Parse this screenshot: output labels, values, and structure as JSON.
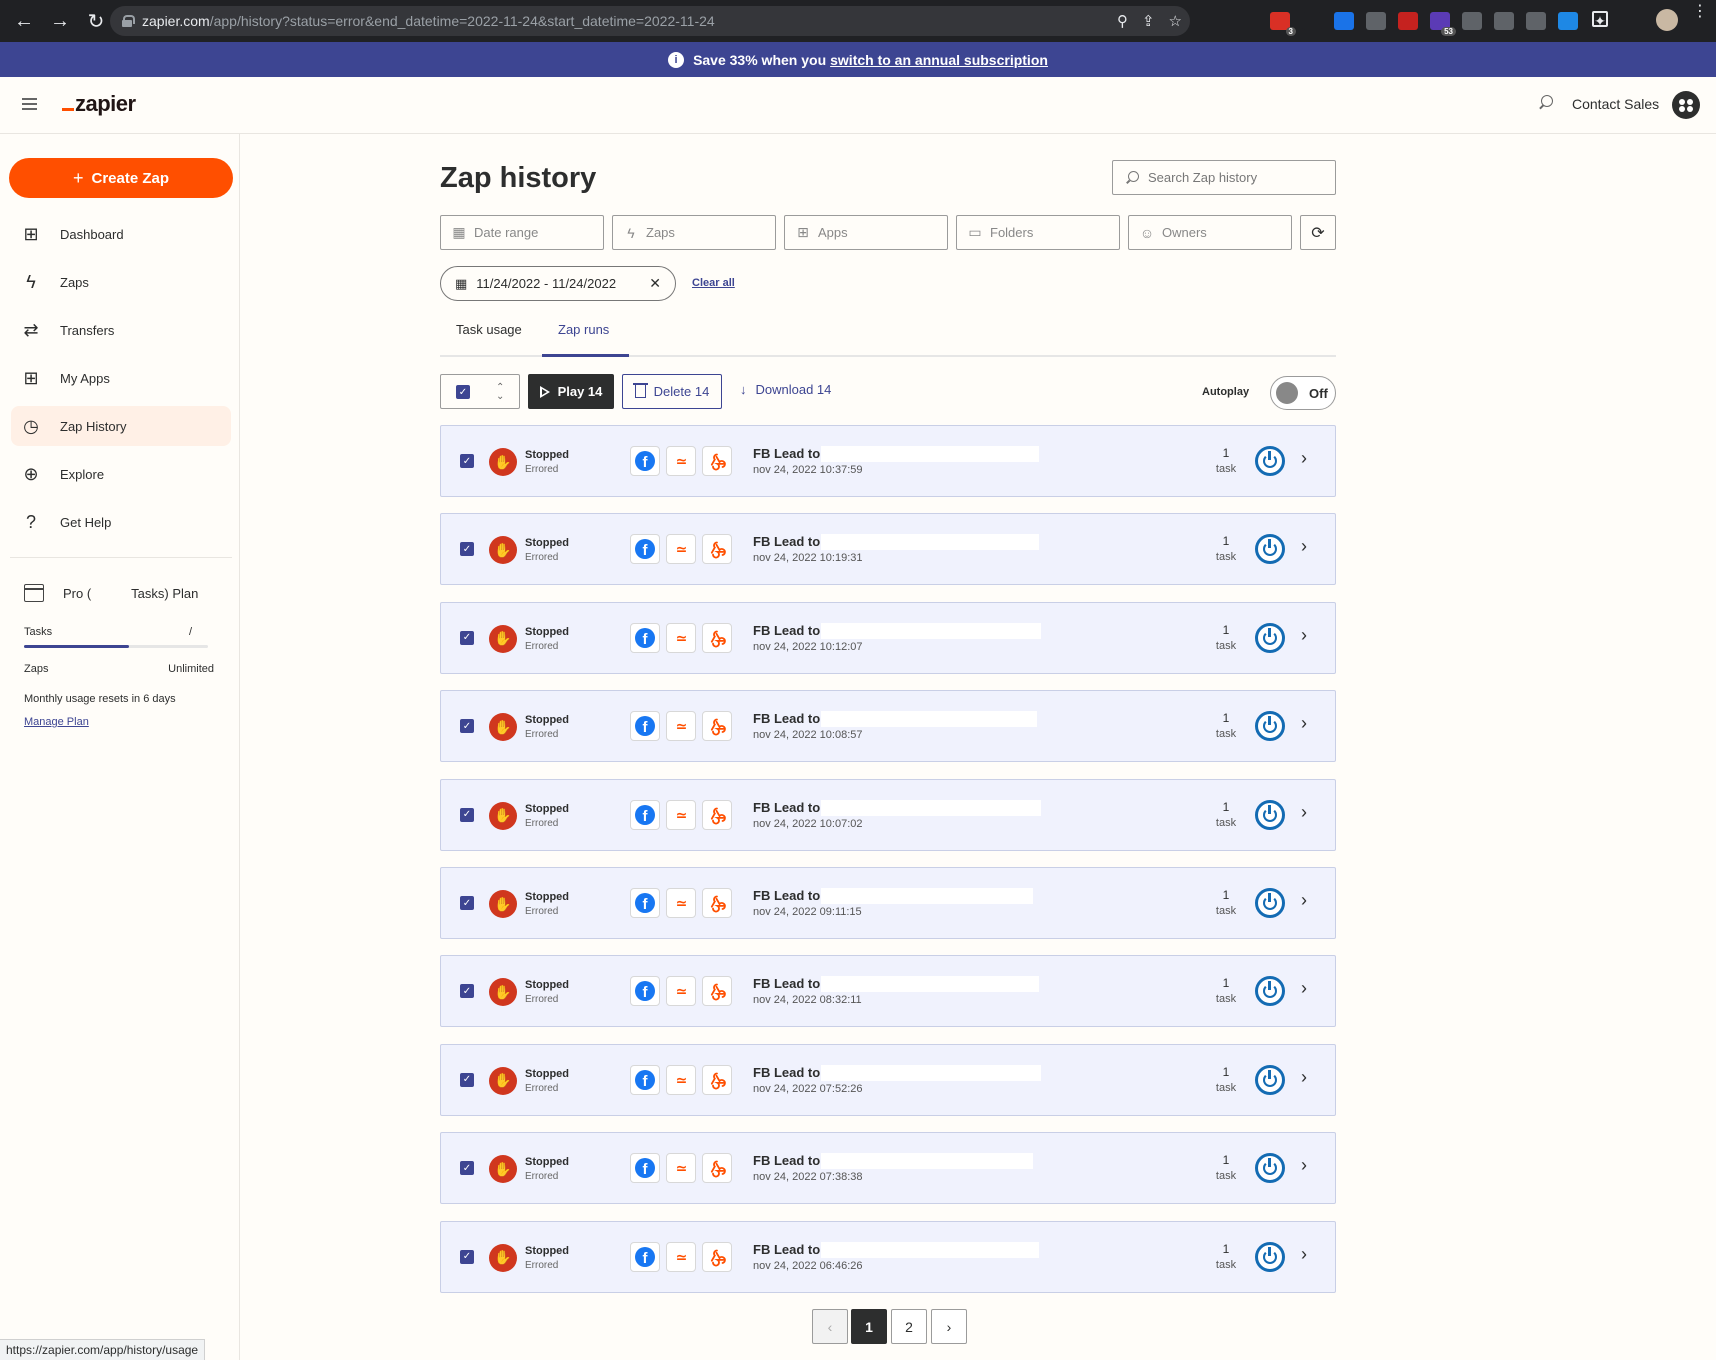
{
  "browser": {
    "url_host": "zapier.com",
    "url_path": "/app/history?status=error&end_datetime=2022-11-24&start_datetime=2022-11-24",
    "extensions": [
      {
        "icon": "red-ext-icon",
        "color": "#d93025",
        "badge": "3"
      },
      {
        "icon": "e-ext-icon",
        "color": "#202124",
        "badge": ""
      },
      {
        "icon": "blue-ext-icon",
        "color": "#1a73e8",
        "badge": ""
      },
      {
        "icon": "code-ext-icon",
        "color": "#5f6368",
        "badge": ""
      },
      {
        "icon": "dots-ext-icon",
        "color": "#c5221f",
        "badge": ""
      },
      {
        "icon": "purple-ext-icon",
        "color": "#5b3bb5",
        "badge": "53"
      },
      {
        "icon": "d-ext-icon",
        "color": "#5f6368",
        "badge": ""
      },
      {
        "icon": "pill-ext-icon",
        "color": "#5f6368",
        "badge": ""
      },
      {
        "icon": "glasses-ext-icon",
        "color": "#5f6368",
        "badge": ""
      },
      {
        "icon": "snowflake-ext-icon",
        "color": "#1e88e5",
        "badge": ""
      }
    ]
  },
  "promo": {
    "text": "Save 33% when you",
    "link": "switch to an annual subscription"
  },
  "header": {
    "logo": "zapier",
    "contact_sales": "Contact Sales"
  },
  "sidebar": {
    "create_zap": "Create Zap",
    "items": [
      {
        "label": "Dashboard",
        "icon": "dashboard-icon",
        "glyph": "⊞"
      },
      {
        "label": "Zaps",
        "icon": "zap-icon",
        "glyph": "ϟ"
      },
      {
        "label": "Transfers",
        "icon": "transfers-icon",
        "glyph": "⇄"
      },
      {
        "label": "My Apps",
        "icon": "apps-icon",
        "glyph": "⊞"
      },
      {
        "label": "Zap History",
        "icon": "history-icon",
        "glyph": "◷",
        "active": true
      },
      {
        "label": "Explore",
        "icon": "explore-icon",
        "glyph": "⊕"
      },
      {
        "label": "Get Help",
        "icon": "help-icon",
        "glyph": "?"
      }
    ],
    "plan": {
      "title_start": "Pro (",
      "title_end": "Tasks) Plan",
      "tasks_label": "Tasks",
      "tasks_value": "/",
      "tasks_progress": 0.57,
      "zaps_label": "Zaps",
      "zaps_value": "Unlimited",
      "reset_text": "Monthly usage resets in 6 days",
      "manage_link": "Manage Plan"
    }
  },
  "main": {
    "title": "Zap history",
    "search_placeholder": "Search Zap history",
    "filters": [
      {
        "label": "Date range",
        "icon": "calendar-icon"
      },
      {
        "label": "Zaps",
        "icon": "zap-icon"
      },
      {
        "label": "Apps",
        "icon": "apps-icon"
      },
      {
        "label": "Folders",
        "icon": "folder-icon"
      },
      {
        "label": "Owners",
        "icon": "user-icon"
      }
    ],
    "date_chip": "11/24/2022 - 11/24/2022",
    "clear_all": "Clear all",
    "tabs": [
      {
        "label": "Task usage"
      },
      {
        "label": "Zap runs",
        "active": true
      }
    ],
    "toolbar": {
      "play": "Play 14",
      "delete": "Delete 14",
      "download": "Download 14",
      "autoplay_label": "Autoplay",
      "autoplay_state": "Off"
    },
    "runs": [
      {
        "status": "Stopped",
        "sub": "Errored",
        "name": "FB Lead to",
        "time": "nov 24, 2022 10:37:59",
        "count": "1",
        "unit": "task"
      },
      {
        "status": "Stopped",
        "sub": "Errored",
        "name": "FB Lead to",
        "time": "nov 24, 2022 10:19:31",
        "count": "1",
        "unit": "task"
      },
      {
        "status": "Stopped",
        "sub": "Errored",
        "name": "FB Lead to",
        "time": "nov 24, 2022 10:12:07",
        "count": "1",
        "unit": "task"
      },
      {
        "status": "Stopped",
        "sub": "Errored",
        "name": "FB Lead to",
        "time": "nov 24, 2022 10:08:57",
        "count": "1",
        "unit": "task"
      },
      {
        "status": "Stopped",
        "sub": "Errored",
        "name": "FB Lead to",
        "time": "nov 24, 2022 10:07:02",
        "count": "1",
        "unit": "task"
      },
      {
        "status": "Stopped",
        "sub": "Errored",
        "name": "FB Lead to",
        "time": "nov 24, 2022 09:11:15",
        "count": "1",
        "unit": "task"
      },
      {
        "status": "Stopped",
        "sub": "Errored",
        "name": "FB Lead to",
        "time": "nov 24, 2022 08:32:11",
        "count": "1",
        "unit": "task"
      },
      {
        "status": "Stopped",
        "sub": "Errored",
        "name": "FB Lead to",
        "time": "nov 24, 2022 07:52:26",
        "count": "1",
        "unit": "task"
      },
      {
        "status": "Stopped",
        "sub": "Errored",
        "name": "FB Lead to",
        "time": "nov 24, 2022 07:38:38",
        "count": "1",
        "unit": "task"
      },
      {
        "status": "Stopped",
        "sub": "Errored",
        "name": "FB Lead to",
        "time": "nov 24, 2022 06:46:26",
        "count": "1",
        "unit": "task"
      }
    ],
    "pagination": {
      "prev": "‹",
      "pages": [
        "1",
        "2"
      ],
      "current": "1",
      "next": "›"
    }
  },
  "status_bar_url": "https://zapier.com/app/history/usage"
}
